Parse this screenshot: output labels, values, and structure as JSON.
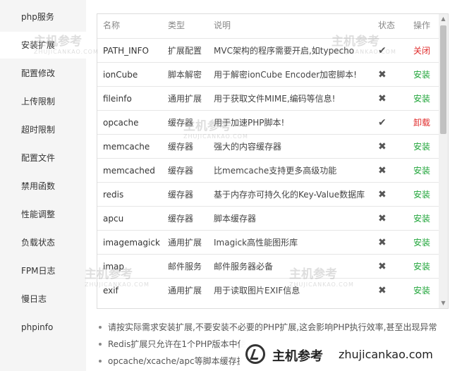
{
  "sidebar": {
    "items": [
      {
        "label": "php服务"
      },
      {
        "label": "安装扩展"
      },
      {
        "label": "配置修改"
      },
      {
        "label": "上传限制"
      },
      {
        "label": "超时限制"
      },
      {
        "label": "配置文件"
      },
      {
        "label": "禁用函数"
      },
      {
        "label": "性能调整"
      },
      {
        "label": "负载状态"
      },
      {
        "label": "FPM日志"
      },
      {
        "label": "慢日志"
      },
      {
        "label": "phpinfo"
      }
    ]
  },
  "table": {
    "headers": {
      "name": "名称",
      "type": "类型",
      "desc": "说明",
      "status": "状态",
      "op": "操作"
    },
    "rows": [
      {
        "name": "PATH_INFO",
        "type": "扩展配置",
        "desc": "MVC架构的程序需要开启,如typecho",
        "status": "✔",
        "op": "关闭"
      },
      {
        "name": "ionCube",
        "type": "脚本解密",
        "desc": "用于解密ionCube Encoder加密脚本!",
        "status": "✖",
        "op": "安装"
      },
      {
        "name": "fileinfo",
        "type": "通用扩展",
        "desc": "用于获取文件MIME,编码等信息!",
        "status": "✖",
        "op": "安装"
      },
      {
        "name": "opcache",
        "type": "缓存器",
        "desc": "用于加速PHP脚本!",
        "status": "✔",
        "op": "卸载"
      },
      {
        "name": "memcache",
        "type": "缓存器",
        "desc": "强大的内容缓存器",
        "status": "✖",
        "op": "安装"
      },
      {
        "name": "memcached",
        "type": "缓存器",
        "desc": "比memcache支持更多高级功能",
        "status": "✖",
        "op": "安装"
      },
      {
        "name": "redis",
        "type": "缓存器",
        "desc": "基于内存亦可持久化的Key-Value数据库",
        "status": "✖",
        "op": "安装"
      },
      {
        "name": "apcu",
        "type": "缓存器",
        "desc": "脚本缓存器",
        "status": "✖",
        "op": "安装"
      },
      {
        "name": "imagemagick",
        "type": "通用扩展",
        "desc": "Imagick高性能图形库",
        "status": "✖",
        "op": "安装"
      },
      {
        "name": "imap",
        "type": "邮件服务",
        "desc": "邮件服务器必备",
        "status": "✖",
        "op": "安装"
      },
      {
        "name": "exif",
        "type": "通用扩展",
        "desc": "用于读取图片EXIF信息",
        "status": "✖",
        "op": "安装"
      }
    ]
  },
  "notes": [
    "请按实际需求安装扩展,不要安装不必要的PHP扩展,这会影响PHP执行效率,甚至出现异常",
    "Redis扩展只允许在1个PHP版本中使",
    "opcache/xcache/apc等脚本缓存扩"
  ],
  "watermark": {
    "cn": "主机参考",
    "en": "ZHUJICANKAO.COM",
    "badge_cn": "主机参考",
    "badge_en": "zhujicankao.com"
  },
  "colors": {
    "install": "#20a53a",
    "danger": "#e02b2b",
    "sidebar_bg": "#f5f5f5"
  }
}
